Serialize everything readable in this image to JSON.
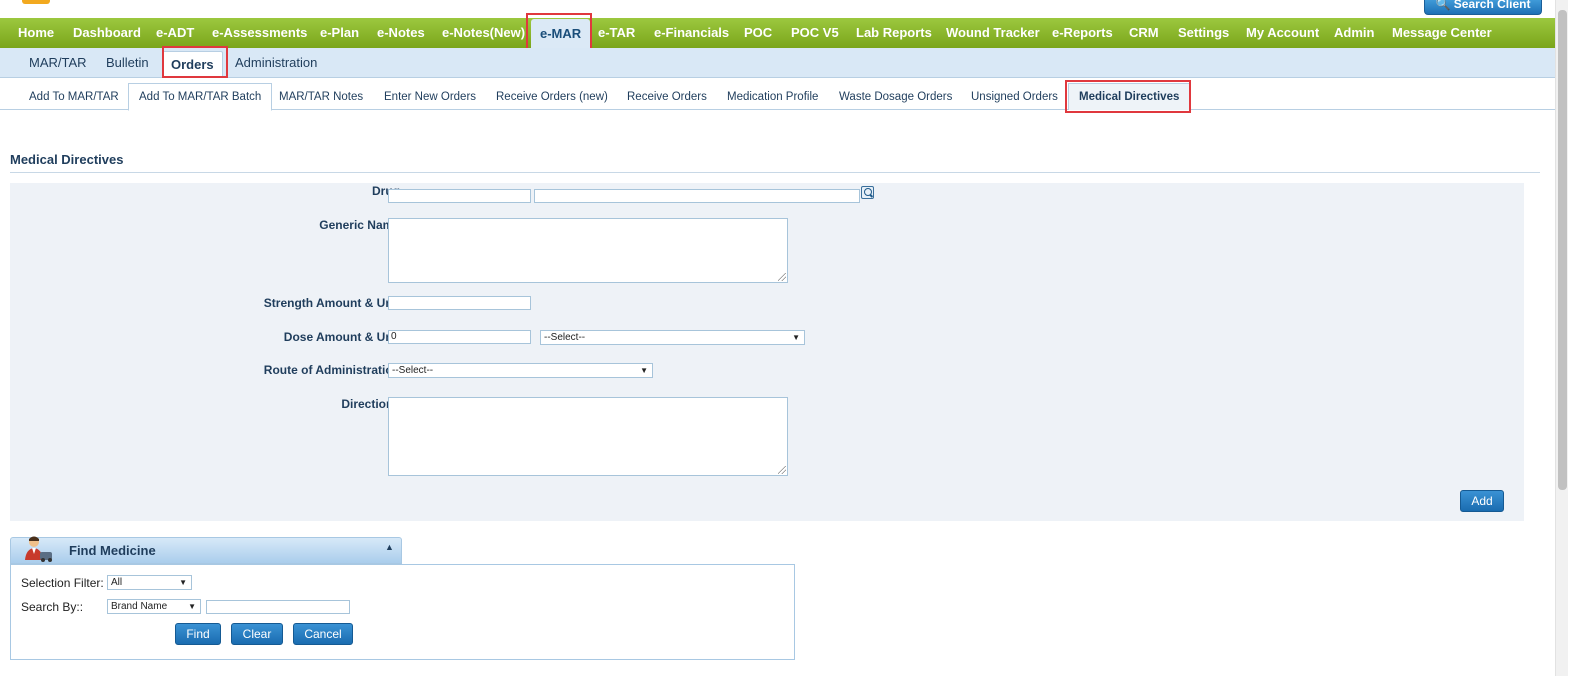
{
  "header": {
    "search_client_label": "Search Client"
  },
  "main_nav": {
    "items": [
      "Home",
      "Dashboard",
      "e-ADT",
      "e-Assessments",
      "e-Plan",
      "e-Notes",
      "e-Notes(New)",
      "e-MAR",
      "e-TAR",
      "e-Financials",
      "POC",
      "POC V5",
      "Lab Reports",
      "Wound Tracker",
      "e-Reports",
      "CRM",
      "Settings",
      "My Account",
      "Admin",
      "Message Center"
    ],
    "active": "e-MAR"
  },
  "sub_nav": {
    "items": [
      "MAR/TAR",
      "Bulletin",
      "Orders",
      "Administration"
    ],
    "active": "Orders"
  },
  "tabs": {
    "items": [
      "Add To MAR/TAR",
      "Add To MAR/TAR Batch",
      "MAR/TAR Notes",
      "Enter New Orders",
      "Receive Orders (new)",
      "Receive Orders",
      "Medication Profile",
      "Waste Dosage Orders",
      "Unsigned Orders",
      "Medical Directives"
    ],
    "active": "Medical Directives"
  },
  "form": {
    "title": "Medical Directives",
    "labels": {
      "drug": "Drug",
      "generic_name": "Generic Name",
      "strength": "Strength Amount & Unit",
      "dose": "Dose Amount & Unit",
      "route": "Route of Administration",
      "directions": "Directions"
    },
    "dose_value": "0",
    "dose_unit_selected": "--Select--",
    "route_selected": "--Select--",
    "add_button": "Add"
  },
  "find_medicine": {
    "title": "Find Medicine",
    "selection_filter_label": "Selection Filter:",
    "selection_filter_value": "All",
    "search_by_label": "Search By::",
    "search_by_value": "Brand Name",
    "find_button": "Find",
    "clear_button": "Clear",
    "cancel_button": "Cancel"
  },
  "colors": {
    "nav_green": "#8ab72c",
    "subnav_blue": "#d9e8f6",
    "button_blue": "#1a6cb0",
    "highlight_red": "#e0383e",
    "panel_bg": "#eef2f7"
  }
}
